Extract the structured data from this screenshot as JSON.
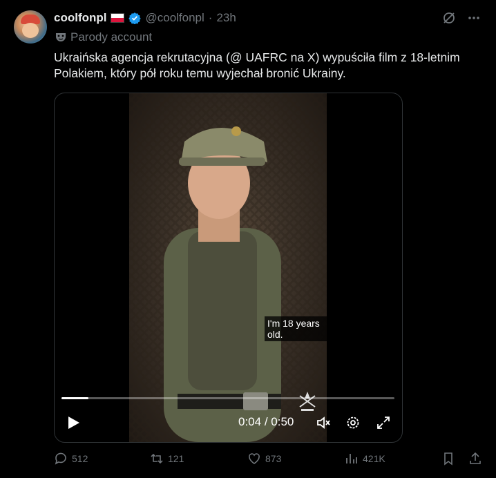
{
  "author": {
    "name": "coolfonpl",
    "handle": "@coolfonpl",
    "separator": "·",
    "time": "23h",
    "label": "Parody account"
  },
  "post": {
    "text": "Ukraińska agencja rekrutacyjna (@ UAFRC na X) wypuściła film z 18-letnim\nPolakiem, który pół roku temu wyjechał bronić Ukrainy."
  },
  "video": {
    "subtitle": "I'm 18 years old.",
    "current_time": "0:04",
    "time_sep": " / ",
    "duration": "0:50",
    "progress": 0.08
  },
  "actions": {
    "replies": "512",
    "reposts": "121",
    "likes": "873",
    "views": "421K"
  },
  "colors": {
    "background": "#000000",
    "text": "#e7e9ea",
    "muted": "#71767b",
    "verified": "#1d9bf0",
    "border": "#2f3336"
  }
}
